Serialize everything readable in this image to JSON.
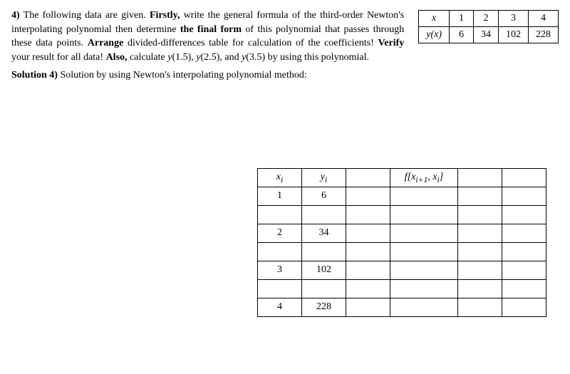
{
  "question": {
    "number": "4)",
    "body_parts": [
      " The following data are given. ",
      "Firstly,",
      " write the general formula of the third-order Newton's interpolating polynomial then determine ",
      "the final form",
      " of this polynomial that passes through these data points. ",
      "Arrange",
      " divided-differences table for calculation of the coefficients! ",
      "Verify",
      " your result for all data! ",
      "Also,",
      " calculate ",
      "y",
      "(1.5), ",
      "y",
      "(2.5), and ",
      "y",
      "(3.5) by using this polynomial."
    ],
    "solution_label_bold": "Solution 4)",
    "solution_label_rest": " Solution by using Newton's interpolating polynomial method:"
  },
  "data_table": {
    "row_headers": [
      "x",
      "y(x)"
    ],
    "x": [
      "1",
      "2",
      "3",
      "4"
    ],
    "y": [
      "6",
      "34",
      "102",
      "228"
    ]
  },
  "dd_table": {
    "headers": {
      "xi": "x",
      "xi_sub": "i",
      "yi": "y",
      "yi_sub": "i",
      "fdd": "f[x",
      "fdd_sub1": "i+1",
      "fdd_mid": ", x",
      "fdd_sub2": "i",
      "fdd_end": "]"
    },
    "rows": [
      {
        "xi": "1",
        "yi": "6"
      },
      {
        "xi": "",
        "yi": ""
      },
      {
        "xi": "2",
        "yi": "34"
      },
      {
        "xi": "",
        "yi": ""
      },
      {
        "xi": "3",
        "yi": "102"
      },
      {
        "xi": "",
        "yi": ""
      },
      {
        "xi": "4",
        "yi": "228"
      }
    ]
  }
}
